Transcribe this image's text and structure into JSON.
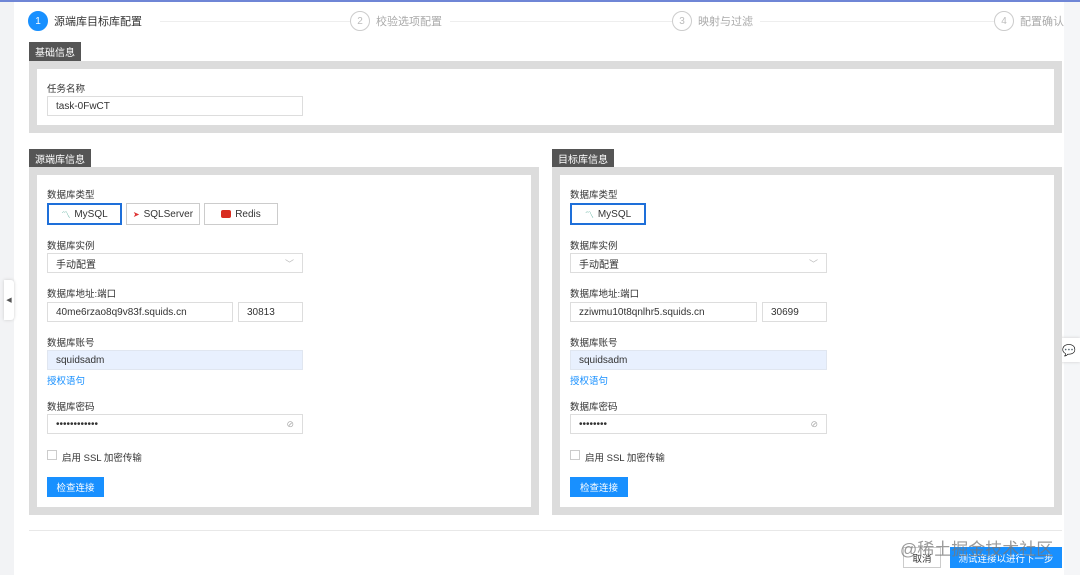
{
  "steps": [
    {
      "num": "1",
      "label": "源端库目标库配置",
      "active": true
    },
    {
      "num": "2",
      "label": "校验选项配置"
    },
    {
      "num": "3",
      "label": "映射与过滤"
    },
    {
      "num": "4",
      "label": "配置确认"
    }
  ],
  "basic": {
    "tab": "基础信息",
    "task_label": "任务名称",
    "task_value": "task-0FwCT"
  },
  "source": {
    "tab": "源端库信息",
    "type_label": "数据库类型",
    "types": [
      {
        "label": "MySQL",
        "icon": "mysql-dolphin-icon"
      },
      {
        "label": "SQLServer",
        "icon": "sqlserver-icon"
      },
      {
        "label": "Redis",
        "icon": "redis-icon"
      }
    ],
    "instance_label": "数据库实例",
    "instance_value": "手动配置",
    "addr_label": "数据库地址:端口",
    "host": "40me6rzao8q9v83f.squids.cn",
    "port": "30813",
    "account_label": "数据库账号",
    "account": "squidsadm",
    "grant_link": "授权语句",
    "password_label": "数据库密码",
    "password": "••••••••••••",
    "ssl_label": "启用 SSL 加密传输",
    "check_button": "检查连接"
  },
  "target": {
    "tab": "目标库信息",
    "type_label": "数据库类型",
    "types": [
      {
        "label": "MySQL",
        "icon": "mysql-dolphin-icon"
      }
    ],
    "instance_label": "数据库实例",
    "instance_value": "手动配置",
    "addr_label": "数据库地址:端口",
    "host": "zziwmu10t8qnlhr5.squids.cn",
    "port": "30699",
    "account_label": "数据库账号",
    "account": "squidsadm",
    "grant_link": "授权语句",
    "password_label": "数据库密码",
    "password": "••••••••",
    "ssl_label": "启用 SSL 加密传输",
    "check_button": "检查连接"
  },
  "footer": {
    "cancel": "取消",
    "next": "测试连接以进行下一步"
  },
  "watermark": "@稀土掘金技术社区",
  "colors": {
    "accent": "#1890ff",
    "tab_bg": "#555555",
    "panel_border": "#dcdcdc",
    "filled_input": "#e8f0fe"
  }
}
